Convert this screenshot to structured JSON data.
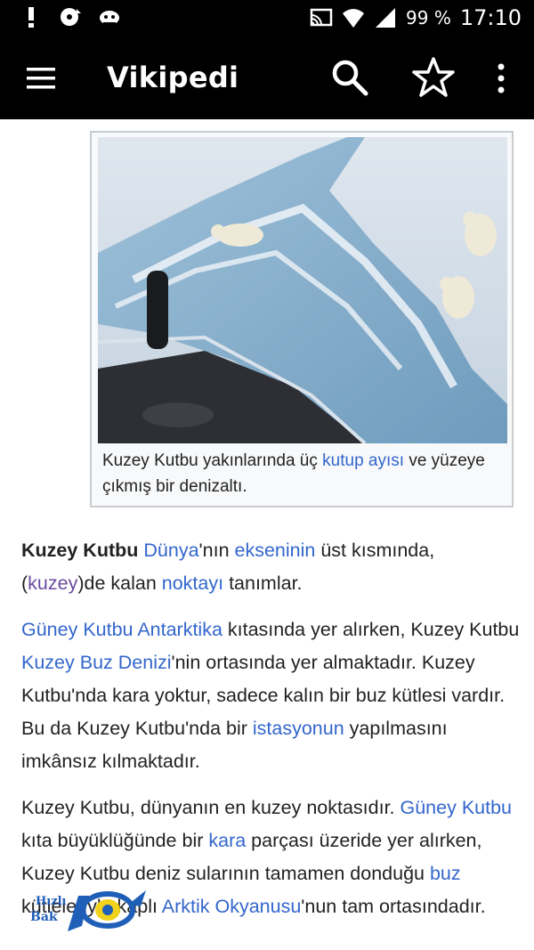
{
  "status_bar": {
    "icons_left": [
      "alert-icon",
      "sync-disc-icon",
      "cloud-fish-icon"
    ],
    "icons_right": [
      "cast-icon",
      "wifi-icon",
      "cell-signal-icon"
    ],
    "battery": "99 %",
    "time": "17:10"
  },
  "app_bar": {
    "title": "Vikipedi",
    "actions": [
      "menu-icon",
      "search-icon",
      "star-icon",
      "more-vert-icon"
    ]
  },
  "figure": {
    "caption_pre": "Kuzey Kutbu yakınlarında üç ",
    "caption_link": "kutup ayısı",
    "caption_post": " ve yüzeye çıkmış bir denizaltı."
  },
  "article": {
    "p1": {
      "bold": "Kuzey Kutbu",
      "t1": " ",
      "link1": "Dünya",
      "t2": "'nın ",
      "link2": "ekseninin",
      "t3": " üst kısmında, (",
      "link3": "kuzey",
      "t4": ")de kalan ",
      "link4": "noktayı",
      "t5": " tanımlar."
    },
    "p2": {
      "link1": "Güney Kutbu",
      "t1": " ",
      "link2": "Antarktika",
      "t2": " kıtasında yer alırken, Kuzey Kutbu ",
      "link3": "Kuzey Buz Denizi",
      "t3": "'nin ortasında yer almaktadır. Kuzey Kutbu'nda kara yoktur, sadece kalın bir buz kütlesi vardır. Bu da Kuzey Kutbu'nda bir ",
      "link4": "istasyonun",
      "t4": " yapılmasını imkânsız kılmaktadır."
    },
    "p3": {
      "t1": "Kuzey Kutbu, dünyanın en kuzey noktasıdır. ",
      "link1": "Güney Kutbu",
      "t2": " kıta büyüklüğünde bir ",
      "link2": "kara",
      "t3": " parçası üzeride yer alırken, Kuzey Kutbu deniz sularının tamamen donduğu ",
      "link3": "buz",
      "t4": " kütleleriyle kaplı ",
      "link4": "Arktik Okyanusu",
      "t5": "'nun tam ortasındadır."
    }
  },
  "watermark": {
    "line1": "Hızlı",
    "line2": "Bak"
  },
  "colors": {
    "link": "#3366cc",
    "visited_link": "#6b4ba1",
    "bar": "#000000",
    "text": "#222222"
  }
}
